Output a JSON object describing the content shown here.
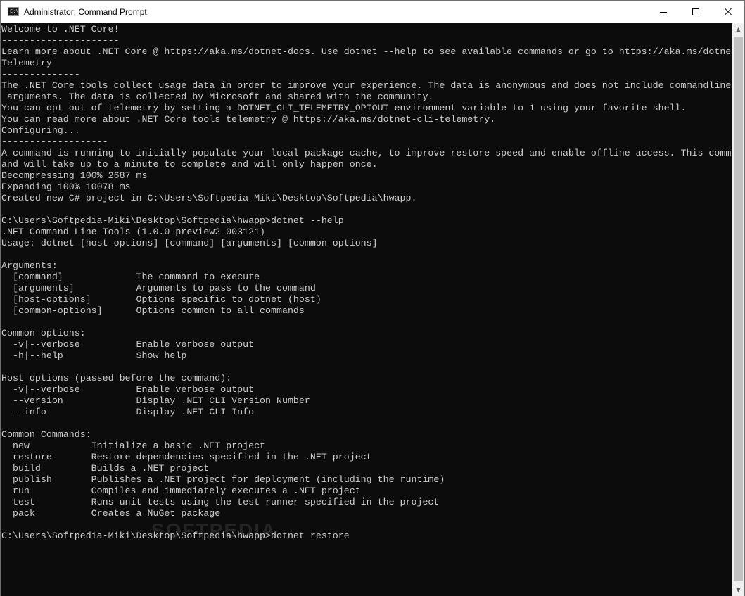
{
  "window": {
    "title": "Administrator: Command Prompt",
    "icon_name": "cmd-icon",
    "icon_text": "C:\\"
  },
  "controls": {
    "minimize_icon": "minimize-icon",
    "maximize_icon": "maximize-icon",
    "close_icon": "close-icon"
  },
  "console": {
    "text": "Welcome to .NET Core!\n---------------------\nLearn more about .NET Core @ https://aka.ms/dotnet-docs. Use dotnet --help to see available commands or go to https://aka.ms/dotnet-cli-docs.\nTelemetry\n--------------\nThe .NET Core tools collect usage data in order to improve your experience. The data is anonymous and does not include commandline\n arguments. The data is collected by Microsoft and shared with the community.\nYou can opt out of telemetry by setting a DOTNET_CLI_TELEMETRY_OPTOUT environment variable to 1 using your favorite shell.\nYou can read more about .NET Core tools telemetry @ https://aka.ms/dotnet-cli-telemetry.\nConfiguring...\n-------------------\nA command is running to initially populate your local package cache, to improve restore speed and enable offline access. This comm\nand will take up to a minute to complete and will only happen once.\nDecompressing 100% 2687 ms\nExpanding 100% 10078 ms\nCreated new C# project in C:\\Users\\Softpedia-Miki\\Desktop\\Softpedia\\hwapp.\n\nC:\\Users\\Softpedia-Miki\\Desktop\\Softpedia\\hwapp>dotnet --help\n.NET Command Line Tools (1.0.0-preview2-003121)\nUsage: dotnet [host-options] [command] [arguments] [common-options]\n\nArguments:\n  [command]             The command to execute\n  [arguments]           Arguments to pass to the command\n  [host-options]        Options specific to dotnet (host)\n  [common-options]      Options common to all commands\n\nCommon options:\n  -v|--verbose          Enable verbose output\n  -h|--help             Show help\n\nHost options (passed before the command):\n  -v|--verbose          Enable verbose output\n  --version             Display .NET CLI Version Number\n  --info                Display .NET CLI Info\n\nCommon Commands:\n  new           Initialize a basic .NET project\n  restore       Restore dependencies specified in the .NET project\n  build         Builds a .NET project\n  publish       Publishes a .NET project for deployment (including the runtime)\n  run           Compiles and immediately executes a .NET project\n  test          Runs unit tests using the test runner specified in the project\n  pack          Creates a NuGet package\n\nC:\\Users\\Softpedia-Miki\\Desktop\\Softpedia\\hwapp>dotnet restore",
    "background": "#0c0c0c",
    "foreground": "#cccccc"
  },
  "watermark": {
    "text": "SOFTPEDIA"
  },
  "scrollbar": {
    "up_icon": "scroll-up-arrow-icon",
    "down_icon": "scroll-down-arrow-icon",
    "up_glyph": "▲",
    "down_glyph": "▼"
  }
}
